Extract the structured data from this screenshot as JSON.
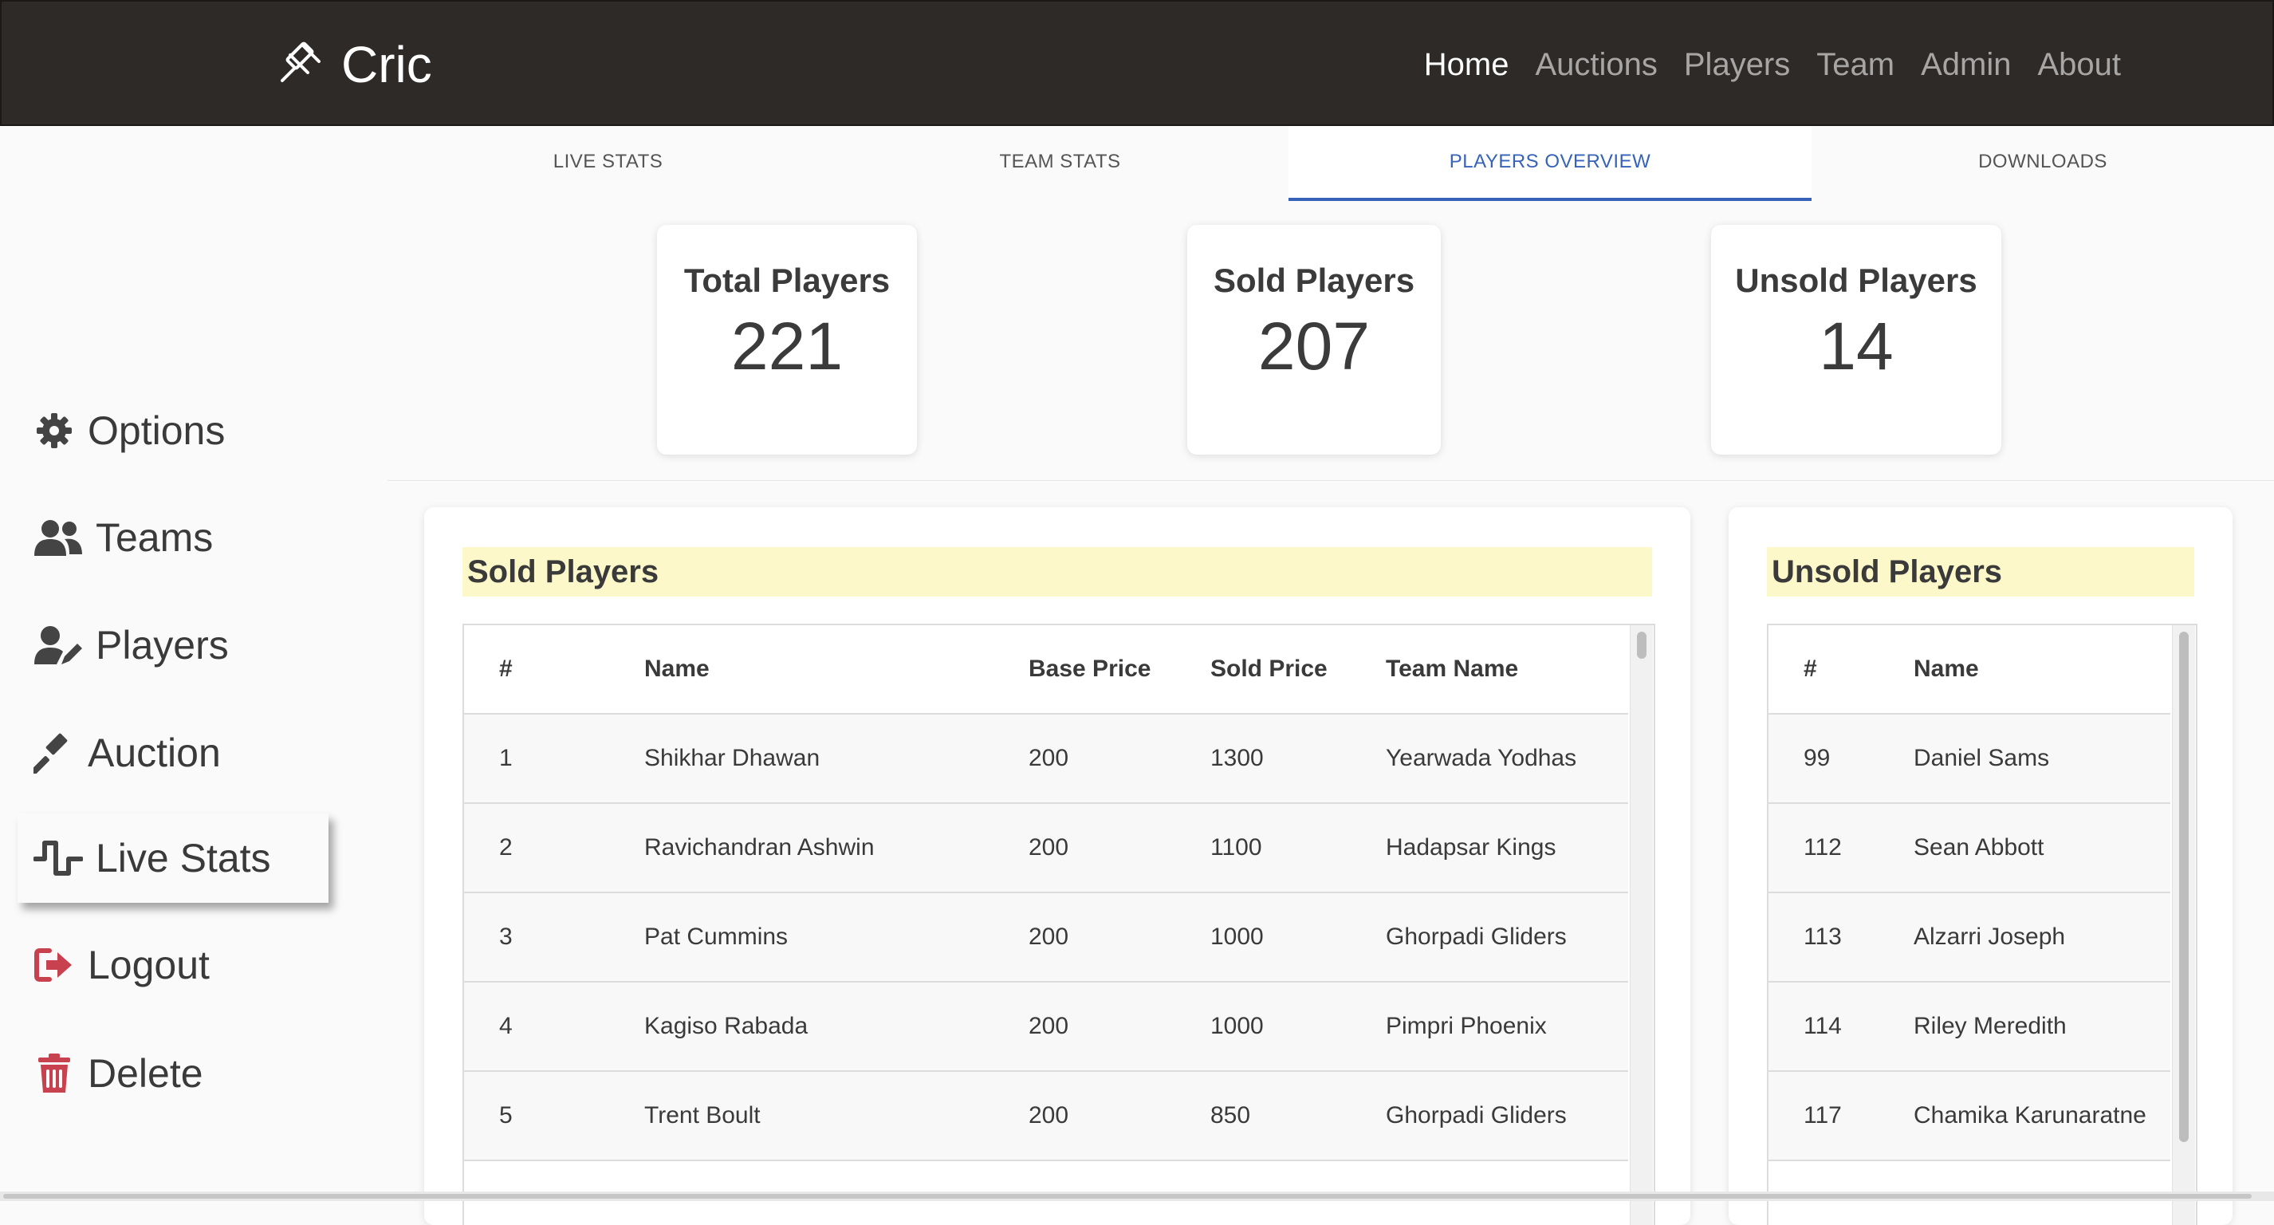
{
  "navbar": {
    "brand": "Cric",
    "links": [
      "Home",
      "Auctions",
      "Players",
      "Team",
      "Admin",
      "About"
    ],
    "active": "Home"
  },
  "tabs": [
    "LIVE STATS",
    "TEAM STATS",
    "PLAYERS OVERVIEW",
    "DOWNLOADS"
  ],
  "active_tab": "PLAYERS OVERVIEW",
  "sidebar": {
    "items": [
      {
        "label": "Options",
        "icon": "gear-icon"
      },
      {
        "label": "Teams",
        "icon": "users-icon"
      },
      {
        "label": "Players",
        "icon": "user-edit-icon"
      },
      {
        "label": "Auction",
        "icon": "gavel-icon"
      },
      {
        "label": "Live Stats",
        "icon": "pulse-icon"
      },
      {
        "label": "Logout",
        "icon": "logout-icon"
      },
      {
        "label": "Delete",
        "icon": "trash-icon"
      }
    ],
    "active": "Live Stats"
  },
  "stats": {
    "total": {
      "title": "Total Players",
      "value": "221"
    },
    "sold": {
      "title": "Sold Players",
      "value": "207"
    },
    "unsold": {
      "title": "Unsold Players",
      "value": "14"
    }
  },
  "sold_table": {
    "heading": "Sold Players",
    "columns": [
      "#",
      "Name",
      "Base Price",
      "Sold Price",
      "Team Name"
    ],
    "rows": [
      [
        "1",
        "Shikhar Dhawan",
        "200",
        "1300",
        "Yearwada Yodhas"
      ],
      [
        "2",
        "Ravichandran Ashwin",
        "200",
        "1100",
        "Hadapsar Kings"
      ],
      [
        "3",
        "Pat Cummins",
        "200",
        "1000",
        "Ghorpadi Gliders"
      ],
      [
        "4",
        "Kagiso Rabada",
        "200",
        "1000",
        "Pimpri Phoenix"
      ],
      [
        "5",
        "Trent Boult",
        "200",
        "850",
        "Ghorpadi Gliders"
      ]
    ]
  },
  "unsold_table": {
    "heading": "Unsold Players",
    "columns": [
      "#",
      "Name"
    ],
    "rows": [
      [
        "99",
        "Daniel Sams"
      ],
      [
        "112",
        "Sean Abbott"
      ],
      [
        "113",
        "Alzarri Joseph"
      ],
      [
        "114",
        "Riley Meredith"
      ],
      [
        "117",
        "Chamika Karunaratne"
      ]
    ]
  },
  "colors": {
    "navbar_bg": "#2d2a28",
    "tab_active": "#3662b8",
    "heading_bg": "#fdf8c9",
    "danger": "#c8414f"
  }
}
